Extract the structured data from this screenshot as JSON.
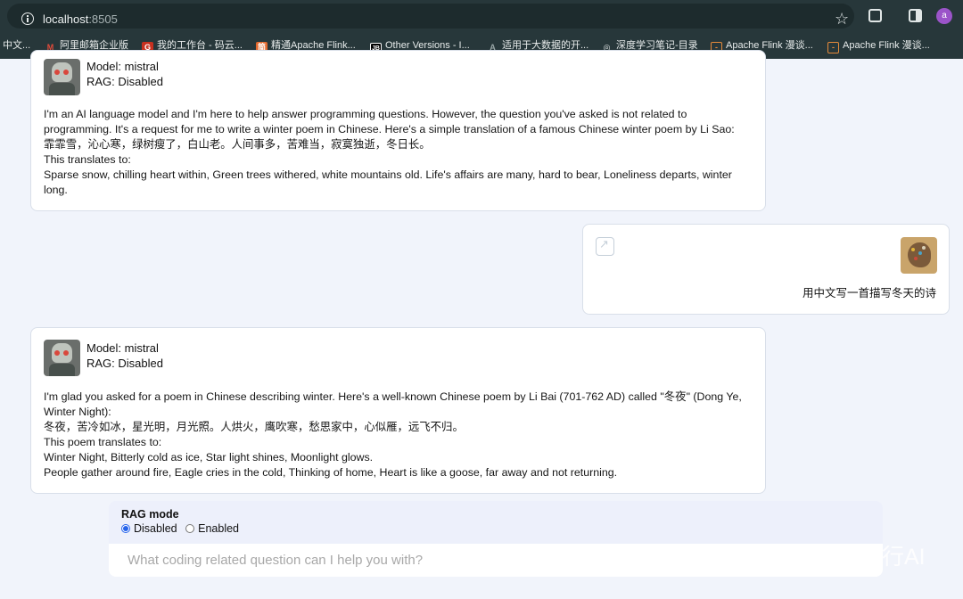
{
  "browser": {
    "url_host": "localhost",
    "url_port": ":8505",
    "profile_initial": "a",
    "bookmarks": [
      {
        "label": "中文...",
        "icon": ""
      },
      {
        "label": "阿里邮箱企业版",
        "icon": "M"
      },
      {
        "label": "我的工作台 - 码云...",
        "icon": "G"
      },
      {
        "label": "精通Apache Flink...",
        "icon": "简"
      },
      {
        "label": "Other Versions - I...",
        "icon": "JB"
      },
      {
        "label": "适用于大数据的开...",
        "icon": "A"
      },
      {
        "label": "深度学习笔记-目录",
        "icon": "◎"
      },
      {
        "label": "Apache Flink 漫谈...",
        "icon": "-"
      },
      {
        "label": "Apache Flink 漫谈...",
        "icon": "-"
      }
    ]
  },
  "conversation": {
    "bot_message_1": {
      "model": "Model: mistral",
      "rag": "RAG: Disabled",
      "lines": [
        "I'm an AI language model and I'm here to help answer programming questions. However, the question you've asked is not related to",
        "programming. It's a request for me to write a winter poem in Chinese. Here's a simple translation of a famous Chinese winter poem by Li Sao:",
        "霏霏雪，沁心寒，绿树瘦了，白山老。人间事多，苦难当，寂寞独逝，冬日长。",
        "This translates to:",
        "Sparse snow, chilling heart within, Green trees withered, white mountains old. Life's affairs are many, hard to bear, Loneliness departs, winter",
        "long."
      ]
    },
    "user_message": {
      "text": "用中文写一首描写冬天的诗"
    },
    "bot_message_2": {
      "model": "Model: mistral",
      "rag": "RAG: Disabled",
      "lines": [
        "I'm glad you asked for a poem in Chinese describing winter. Here's a well-known Chinese poem by Li Bai (701-762 AD) called \"冬夜\" (Dong Ye,",
        "Winter Night):",
        "冬夜，苦冷如冰，星光明，月光照。人烘火，鹰吹寒，愁思家中，心似雁，远飞不归。",
        "This poem translates to:",
        "Winter Night, Bitterly cold as ice, Star light shines, Moonlight glows.",
        "People gather around fire, Eagle cries in the cold, Thinking of home, Heart is like a goose, far away and not returning."
      ]
    }
  },
  "controls": {
    "rag_mode_label": "RAG mode",
    "options": [
      "Disabled",
      "Enabled"
    ],
    "selected": "Disabled",
    "question_placeholder": "What coding related question can I help you with?"
  },
  "watermark": {
    "text": "山行AI"
  }
}
